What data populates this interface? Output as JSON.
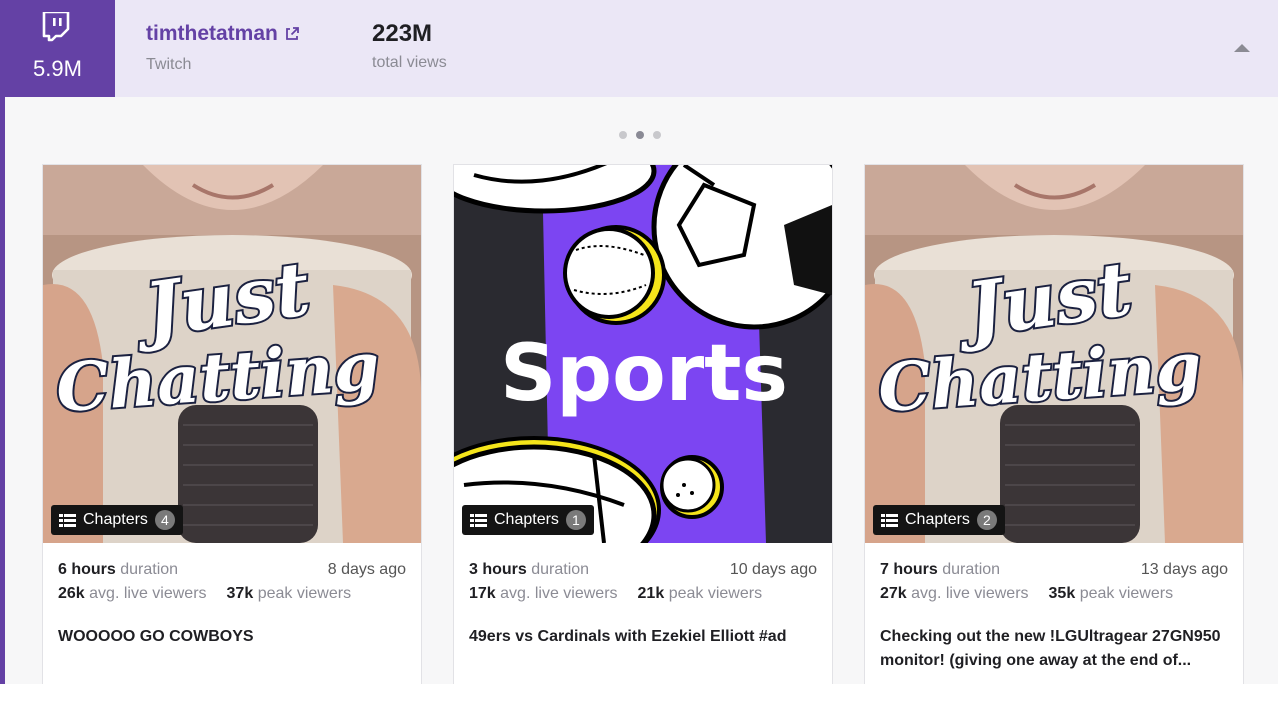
{
  "header": {
    "followers": "5.9M",
    "channel_name": "timthetatman",
    "platform": "Twitch",
    "total_views_value": "223M",
    "total_views_label": "total views"
  },
  "carousel": {
    "page_count": 3,
    "active_index": 1
  },
  "icons": {
    "brand": "twitch-logo-icon",
    "external_link": "external-link-icon",
    "collapse": "chevron-up-icon",
    "chapters": "list-icon"
  },
  "colors": {
    "brand": "#6441a5",
    "header_bg": "#ebe7f6"
  },
  "cards": [
    {
      "category": "Just Chatting",
      "thumbnail_line1": "Just",
      "thumbnail_line2": "Chatting",
      "chapters_label": "Chapters",
      "chapters_count": "4",
      "duration_value": "6 hours",
      "duration_label": "duration",
      "age": "8 days ago",
      "avg_viewers_value": "26k",
      "avg_viewers_label": "avg. live viewers",
      "peak_viewers_value": "37k",
      "peak_viewers_label": "peak viewers",
      "title": "WOOOOO GO COWBOYS"
    },
    {
      "category": "Sports",
      "thumbnail_line1": "Sports",
      "thumbnail_line2": "",
      "chapters_label": "Chapters",
      "chapters_count": "1",
      "duration_value": "3 hours",
      "duration_label": "duration",
      "age": "10 days ago",
      "avg_viewers_value": "17k",
      "avg_viewers_label": "avg. live viewers",
      "peak_viewers_value": "21k",
      "peak_viewers_label": "peak viewers",
      "title": "49ers vs Cardinals with Ezekiel Elliott #ad"
    },
    {
      "category": "Just Chatting",
      "thumbnail_line1": "Just",
      "thumbnail_line2": "Chatting",
      "chapters_label": "Chapters",
      "chapters_count": "2",
      "duration_value": "7 hours",
      "duration_label": "duration",
      "age": "13 days ago",
      "avg_viewers_value": "27k",
      "avg_viewers_label": "avg. live viewers",
      "peak_viewers_value": "35k",
      "peak_viewers_label": "peak viewers",
      "title": "Checking out the new !LGUltragear 27GN950 monitor! (giving one away at the end of..."
    }
  ]
}
